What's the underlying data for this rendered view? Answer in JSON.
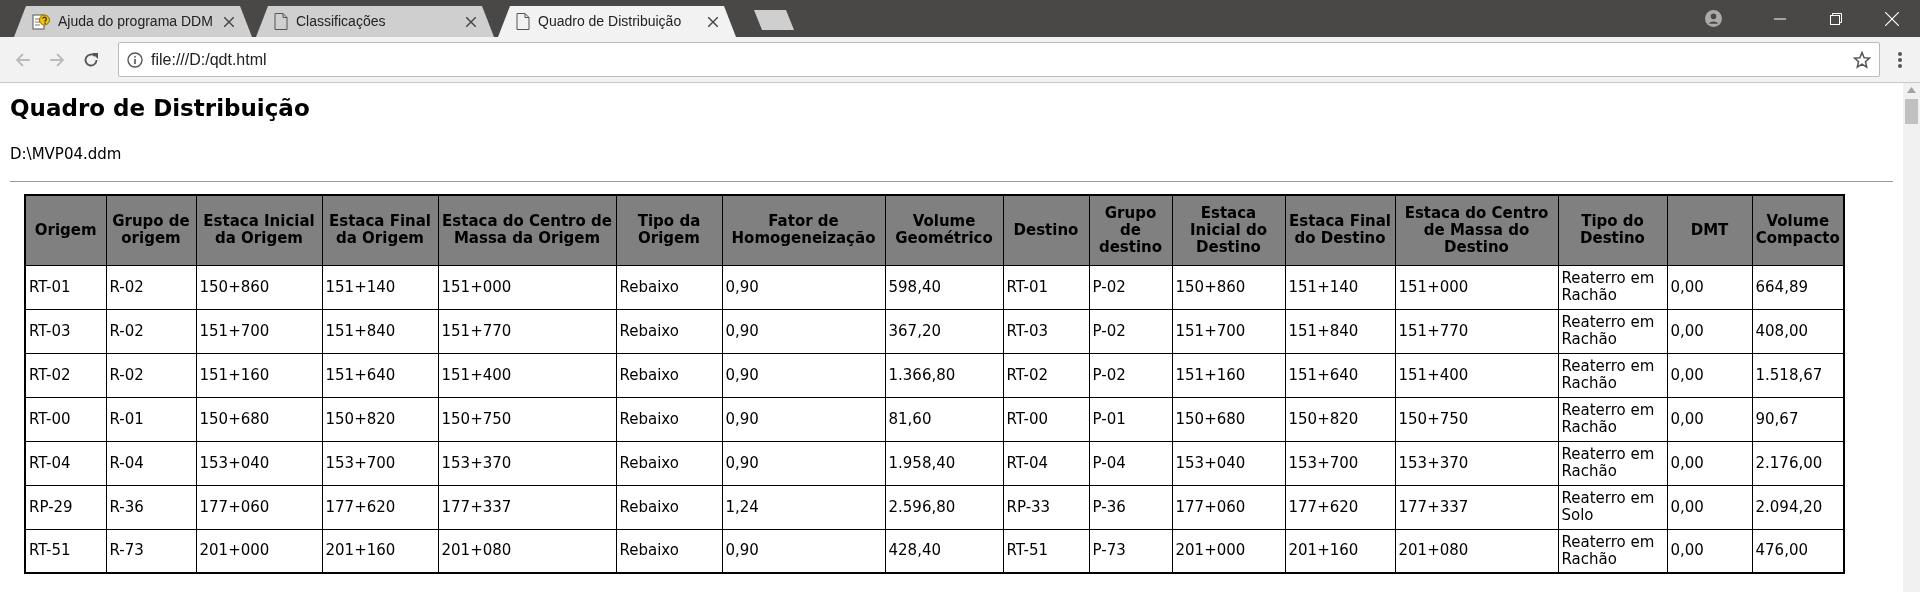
{
  "browser": {
    "tabs": [
      {
        "title": "Ajuda do programa DDM",
        "kind": "help",
        "selected": false
      },
      {
        "title": "Classificações",
        "kind": "page",
        "selected": false
      },
      {
        "title": "Quadro de Distribuição",
        "kind": "page",
        "selected": true
      }
    ],
    "url": "file:///D:/qdt.html"
  },
  "page": {
    "title": "Quadro de Distribuição",
    "file": "D:\\MVP04.ddm",
    "table": {
      "columns": [
        "Origem",
        "Grupo de origem",
        "Estaca Inicial da Origem",
        "Estaca Final da Origem",
        "Estaca do Centro de Massa da Origem",
        "Tipo da Origem",
        "Fator de Homogeneização",
        "Volume Geométrico",
        "Destino",
        "Grupo de destino",
        "Estaca Inicial do Destino",
        "Estaca Final do Destino",
        "Estaca do Centro de Massa do Destino",
        "Tipo do Destino",
        "DMT",
        "Volume Compacto"
      ],
      "rows": [
        [
          "RT-01",
          "R-02",
          "150+860",
          "151+140",
          "151+000",
          "Rebaixo",
          "0,90",
          "598,40",
          "RT-01",
          "P-02",
          "150+860",
          "151+140",
          "151+000",
          "Reaterro em Rachão",
          "0,00",
          "664,89"
        ],
        [
          "RT-03",
          "R-02",
          "151+700",
          "151+840",
          "151+770",
          "Rebaixo",
          "0,90",
          "367,20",
          "RT-03",
          "P-02",
          "151+700",
          "151+840",
          "151+770",
          "Reaterro em Rachão",
          "0,00",
          "408,00"
        ],
        [
          "RT-02",
          "R-02",
          "151+160",
          "151+640",
          "151+400",
          "Rebaixo",
          "0,90",
          "1.366,80",
          "RT-02",
          "P-02",
          "151+160",
          "151+640",
          "151+400",
          "Reaterro em Rachão",
          "0,00",
          "1.518,67"
        ],
        [
          "RT-00",
          "R-01",
          "150+680",
          "150+820",
          "150+750",
          "Rebaixo",
          "0,90",
          "81,60",
          "RT-00",
          "P-01",
          "150+680",
          "150+820",
          "150+750",
          "Reaterro em Rachão",
          "0,00",
          "90,67"
        ],
        [
          "RT-04",
          "R-04",
          "153+040",
          "153+700",
          "153+370",
          "Rebaixo",
          "0,90",
          "1.958,40",
          "RT-04",
          "P-04",
          "153+040",
          "153+700",
          "153+370",
          "Reaterro em Rachão",
          "0,00",
          "2.176,00"
        ],
        [
          "RP-29",
          "R-36",
          "177+060",
          "177+620",
          "177+337",
          "Rebaixo",
          "1,24",
          "2.596,80",
          "RP-33",
          "P-36",
          "177+060",
          "177+620",
          "177+337",
          "Reaterro em Solo",
          "0,00",
          "2.094,20"
        ],
        [
          "RT-51",
          "R-73",
          "201+000",
          "201+160",
          "201+080",
          "Rebaixo",
          "0,90",
          "428,40",
          "RT-51",
          "P-73",
          "201+000",
          "201+160",
          "201+080",
          "Reaterro em Rachão",
          "0,00",
          "476,00"
        ]
      ]
    }
  }
}
